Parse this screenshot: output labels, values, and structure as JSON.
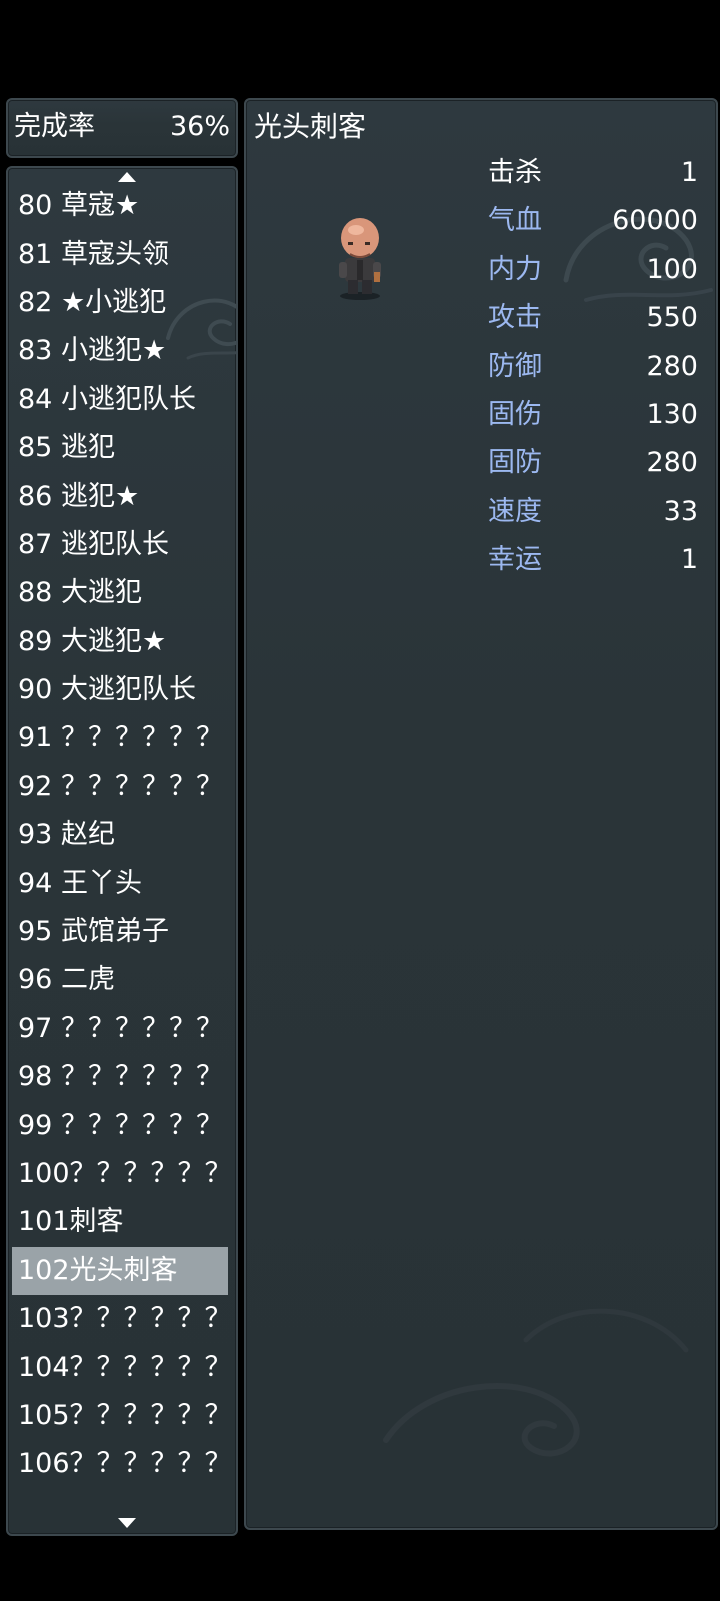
{
  "completion": {
    "label": "完成率",
    "value": "36%"
  },
  "list": {
    "items": [
      "80 草寇★",
      "81 草寇头领",
      "82 ★小逃犯",
      "83 小逃犯★",
      "84 小逃犯队长",
      "85 逃犯",
      "86 逃犯★",
      "87 逃犯队长",
      "88 大逃犯",
      "89 大逃犯★",
      "90 大逃犯队长",
      "91 ？？？？？？",
      "92 ？？？？？？",
      "93 赵纪",
      "94 王丫头",
      "95 武馆弟子",
      "96 二虎",
      "97 ？？？？？？",
      "98 ？？？？？？",
      "99 ？？？？？？",
      "100？？？？？？",
      "101刺客",
      "102光头刺客",
      "103？？？？？？",
      "104？？？？？？",
      "105？？？？？？",
      "106？？？？？？"
    ],
    "selected_index": 22
  },
  "detail": {
    "title": "光头刺客",
    "sprite_icon": "bald-assassin-sprite-icon",
    "stats": [
      {
        "label": "击杀",
        "value": "1",
        "color": "#ffffff"
      },
      {
        "label": "气血",
        "value": "60000",
        "color": "#9cb8f0"
      },
      {
        "label": "内力",
        "value": "100",
        "color": "#9cb8f0"
      },
      {
        "label": "攻击",
        "value": "550",
        "color": "#9cb8f0"
      },
      {
        "label": "防御",
        "value": "280",
        "color": "#9cb8f0"
      },
      {
        "label": "固伤",
        "value": "130",
        "color": "#9cb8f0"
      },
      {
        "label": "固防",
        "value": "280",
        "color": "#9cb8f0"
      },
      {
        "label": "速度",
        "value": "33",
        "color": "#9cb8f0"
      },
      {
        "label": "幸运",
        "value": "1",
        "color": "#9cb8f0"
      }
    ]
  },
  "controls": {
    "settings_icon": "gear-back-icon"
  }
}
